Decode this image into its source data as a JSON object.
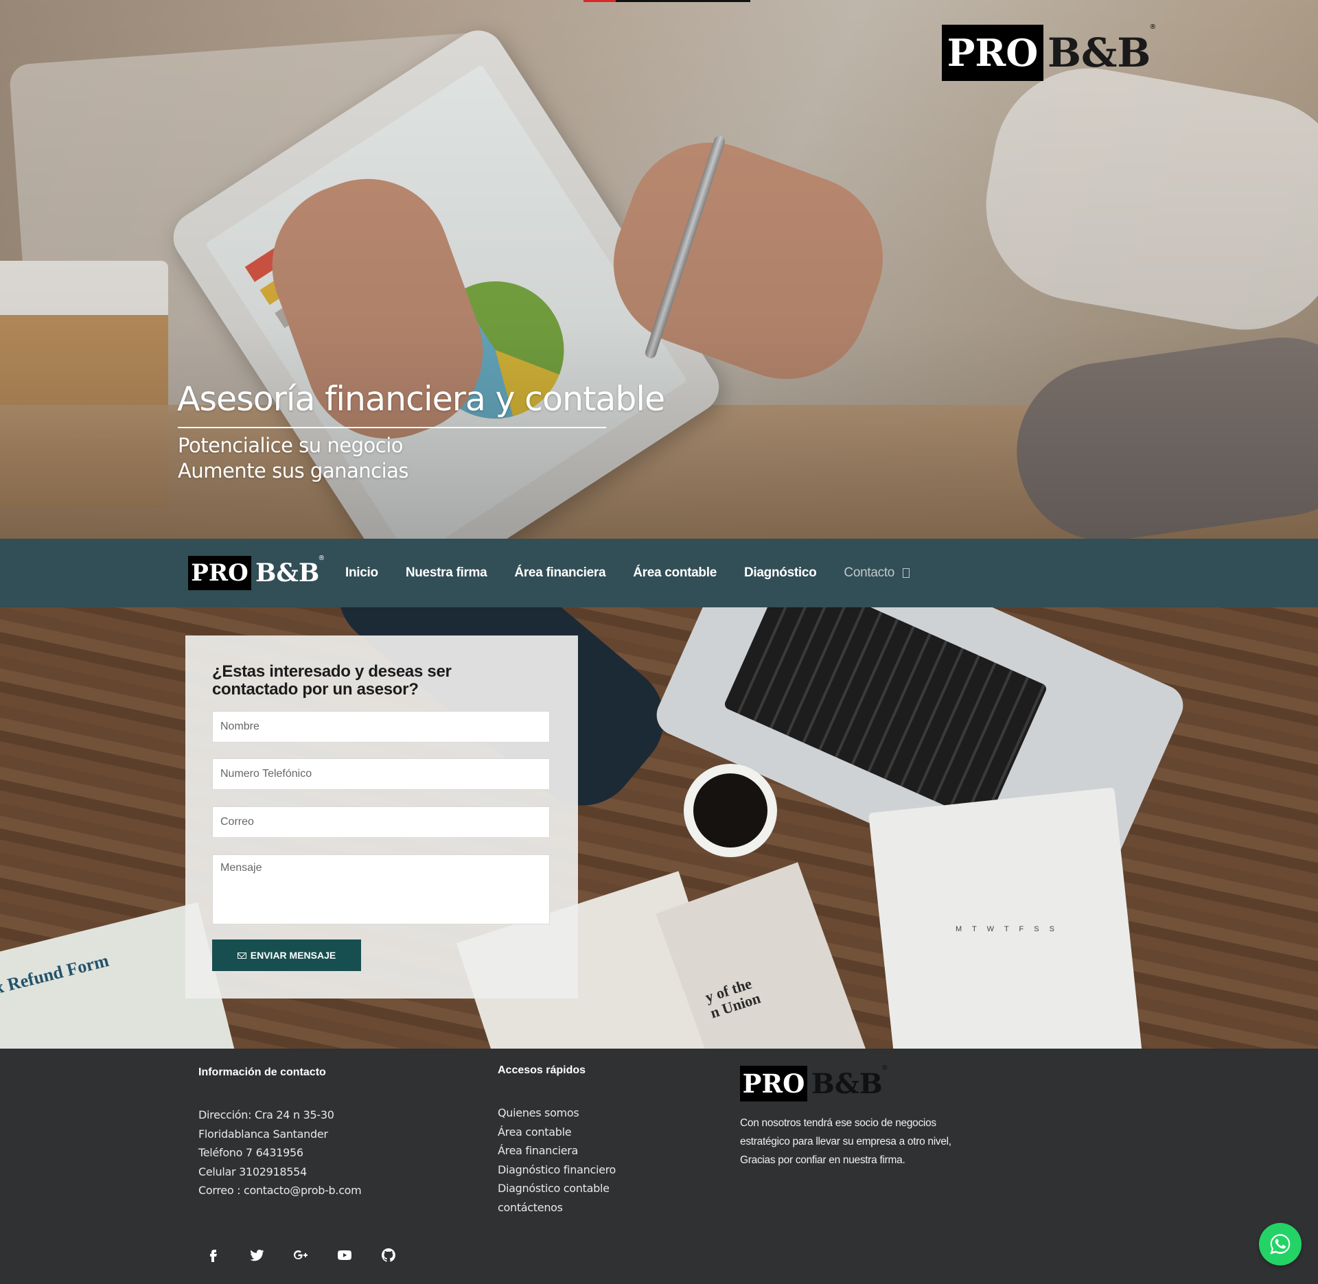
{
  "hero": {
    "title": "Asesoría financiera y contable",
    "subtitle_1": "Potencialice su negocio",
    "subtitle_2": "Aumente sus ganancias",
    "logo": {
      "pro": "PRO",
      "bb": "B&B",
      "reg": "®"
    }
  },
  "nav": {
    "logo": {
      "pro": "PRO",
      "bb": "B&B",
      "reg": "®"
    },
    "items": [
      {
        "label": "Inicio"
      },
      {
        "label": "Nuestra firma"
      },
      {
        "label": "Área financiera"
      },
      {
        "label": "Área contable"
      },
      {
        "label": "Diagnóstico"
      },
      {
        "label": "Contacto"
      }
    ],
    "active_item": "Contacto",
    "background": "#324e56"
  },
  "contact_form": {
    "title": "¿Estas interesado y deseas ser contactado por un asesor?",
    "name_placeholder": "Nombre",
    "phone_placeholder": "Numero Telefónico",
    "email_placeholder": "Correo",
    "message_placeholder": "Mensaje",
    "submit_label": "ENVIAR MENSAJE",
    "submit_icon": "envelope-icon",
    "button_color": "#174f50"
  },
  "desk_photo_text": {
    "clipboard": "x Refund Form",
    "newspaper_line_1": "y of the",
    "newspaper_line_2": "n Union",
    "calendar_days": "M T W T F S S"
  },
  "footer": {
    "contact_heading": "Información de contacto",
    "contact_lines": [
      "Dirección: Cra 24 n 35-30",
      "Floridablanca Santander",
      "Teléfono 7 6431956",
      "Celular 3102918554",
      "Correo : contacto@prob-b.com"
    ],
    "links_heading": "Accesos rápidos",
    "links": [
      "Quienes somos",
      "Área contable",
      "Área financiera",
      "Diagnóstico financiero",
      "Diagnóstico contable",
      "contáctenos"
    ],
    "logo": {
      "pro": "PRO",
      "bb": "B&B",
      "reg": "®"
    },
    "about_text": "Con nosotros tendrá ese socio de negocios estratégico para llevar su empresa a otro nivel, Gracias por confiar en nuestra firma.",
    "social_icons": [
      "facebook-icon",
      "twitter-icon",
      "google-plus-icon",
      "youtube-icon",
      "github-icon"
    ],
    "background": "#2f3133"
  },
  "whatsapp": {
    "icon": "whatsapp-icon",
    "color": "#24d366"
  }
}
